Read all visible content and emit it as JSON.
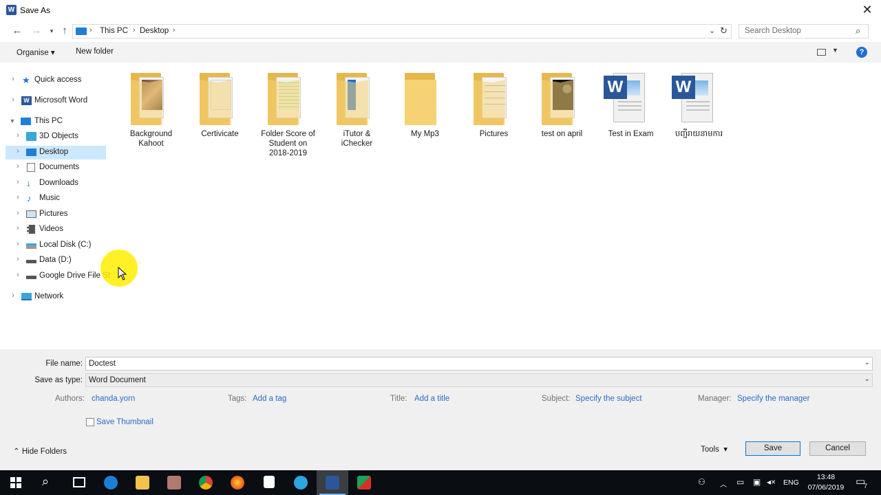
{
  "window": {
    "title": "Save As",
    "app_icon_letter": "W"
  },
  "nav": {
    "breadcrumb": [
      "This PC",
      "Desktop"
    ],
    "search_placeholder": "Search Desktop"
  },
  "toolbar": {
    "organise": "Organise",
    "new_folder": "New folder",
    "help": "?"
  },
  "sidebar": {
    "items": [
      {
        "label": "Quick access",
        "icon": "star-icon",
        "level": 0
      },
      {
        "label": "Microsoft Word",
        "icon": "word-icon",
        "level": 0
      },
      {
        "label": "This PC",
        "icon": "pc-icon",
        "level": 0,
        "expanded": true
      },
      {
        "label": "3D Objects",
        "icon": "cube-icon",
        "level": 1
      },
      {
        "label": "Desktop",
        "icon": "desktop-icon",
        "level": 1,
        "selected": true
      },
      {
        "label": "Documents",
        "icon": "documents-icon",
        "level": 1
      },
      {
        "label": "Downloads",
        "icon": "download-icon",
        "level": 1
      },
      {
        "label": "Music",
        "icon": "music-icon",
        "level": 1
      },
      {
        "label": "Pictures",
        "icon": "pictures-icon",
        "level": 1
      },
      {
        "label": "Videos",
        "icon": "videos-icon",
        "level": 1
      },
      {
        "label": "Local Disk (C:)",
        "icon": "disk-icon",
        "level": 1
      },
      {
        "label": "Data (D:)",
        "icon": "drive-icon",
        "level": 1
      },
      {
        "label": "Google Drive File St",
        "icon": "drive-icon",
        "level": 1
      },
      {
        "label": "Network",
        "icon": "network-icon",
        "level": 0
      }
    ]
  },
  "files": [
    {
      "name_lines": [
        "Background",
        "Kahoot"
      ],
      "kind": "folder-photo"
    },
    {
      "name_lines": [
        "Certivicate"
      ],
      "kind": "folder-doc"
    },
    {
      "name_lines": [
        "Folder Score of",
        "Student on",
        "2018-2019"
      ],
      "kind": "folder-sheet"
    },
    {
      "name_lines": [
        "iTutor &",
        "iChecker"
      ],
      "kind": "folder-blue"
    },
    {
      "name_lines": [
        "My Mp3"
      ],
      "kind": "folder-empty"
    },
    {
      "name_lines": [
        "Pictures"
      ],
      "kind": "folder-doc"
    },
    {
      "name_lines": [
        "test on april"
      ],
      "kind": "folder-dark"
    },
    {
      "name_lines": [
        "Test in Exam"
      ],
      "kind": "word-doc"
    },
    {
      "name_lines": [
        "បញ្ជីរាយនាមការ"
      ],
      "kind": "word-doc"
    }
  ],
  "form": {
    "file_name_label": "File name:",
    "file_name_value": "Doctest",
    "save_type_label": "Save as type:",
    "save_type_value": "Word Document",
    "authors_label": "Authors:",
    "authors_value": "chanda.yorn",
    "tags_label": "Tags:",
    "tags_value": "Add a tag",
    "title_label": "Title:",
    "title_value": "Add a title",
    "subject_label": "Subject:",
    "subject_value": "Specify the subject",
    "manager_label": "Manager:",
    "manager_value": "Specify the manager",
    "thumbnail_label": "Save Thumbnail",
    "hide_folders": "Hide Folders",
    "tools": "Tools",
    "save": "Save",
    "cancel": "Cancel"
  },
  "taskbar": {
    "time": "13:48",
    "date": "07/06/2019",
    "lang": "ENG",
    "notif_count": "7"
  }
}
